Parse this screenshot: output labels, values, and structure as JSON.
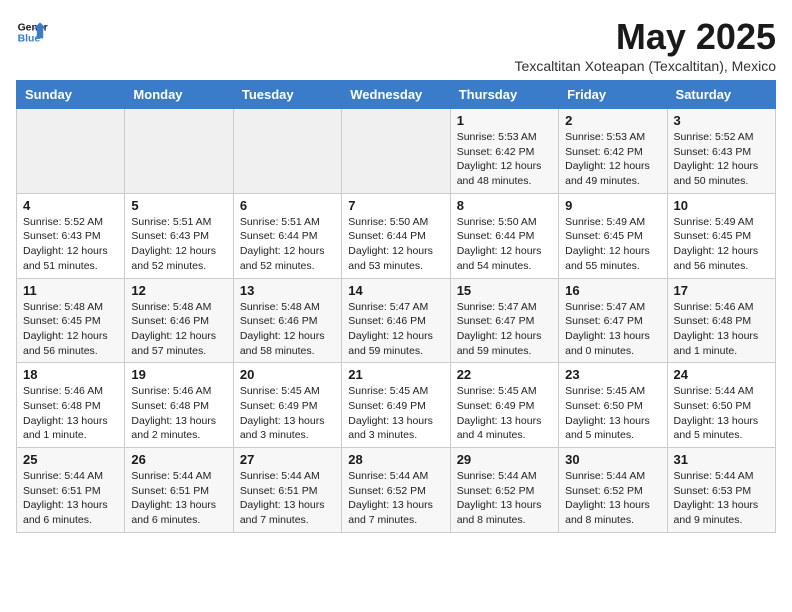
{
  "logo": {
    "line1": "General",
    "line2": "Blue"
  },
  "title": "May 2025",
  "location": "Texcaltitan Xoteapan (Texcaltitan), Mexico",
  "weekdays": [
    "Sunday",
    "Monday",
    "Tuesday",
    "Wednesday",
    "Thursday",
    "Friday",
    "Saturday"
  ],
  "weeks": [
    [
      {
        "day": "",
        "content": ""
      },
      {
        "day": "",
        "content": ""
      },
      {
        "day": "",
        "content": ""
      },
      {
        "day": "",
        "content": ""
      },
      {
        "day": "1",
        "content": "Sunrise: 5:53 AM\nSunset: 6:42 PM\nDaylight: 12 hours and 48 minutes."
      },
      {
        "day": "2",
        "content": "Sunrise: 5:53 AM\nSunset: 6:42 PM\nDaylight: 12 hours and 49 minutes."
      },
      {
        "day": "3",
        "content": "Sunrise: 5:52 AM\nSunset: 6:43 PM\nDaylight: 12 hours and 50 minutes."
      }
    ],
    [
      {
        "day": "4",
        "content": "Sunrise: 5:52 AM\nSunset: 6:43 PM\nDaylight: 12 hours and 51 minutes."
      },
      {
        "day": "5",
        "content": "Sunrise: 5:51 AM\nSunset: 6:43 PM\nDaylight: 12 hours and 52 minutes."
      },
      {
        "day": "6",
        "content": "Sunrise: 5:51 AM\nSunset: 6:44 PM\nDaylight: 12 hours and 52 minutes."
      },
      {
        "day": "7",
        "content": "Sunrise: 5:50 AM\nSunset: 6:44 PM\nDaylight: 12 hours and 53 minutes."
      },
      {
        "day": "8",
        "content": "Sunrise: 5:50 AM\nSunset: 6:44 PM\nDaylight: 12 hours and 54 minutes."
      },
      {
        "day": "9",
        "content": "Sunrise: 5:49 AM\nSunset: 6:45 PM\nDaylight: 12 hours and 55 minutes."
      },
      {
        "day": "10",
        "content": "Sunrise: 5:49 AM\nSunset: 6:45 PM\nDaylight: 12 hours and 56 minutes."
      }
    ],
    [
      {
        "day": "11",
        "content": "Sunrise: 5:48 AM\nSunset: 6:45 PM\nDaylight: 12 hours and 56 minutes."
      },
      {
        "day": "12",
        "content": "Sunrise: 5:48 AM\nSunset: 6:46 PM\nDaylight: 12 hours and 57 minutes."
      },
      {
        "day": "13",
        "content": "Sunrise: 5:48 AM\nSunset: 6:46 PM\nDaylight: 12 hours and 58 minutes."
      },
      {
        "day": "14",
        "content": "Sunrise: 5:47 AM\nSunset: 6:46 PM\nDaylight: 12 hours and 59 minutes."
      },
      {
        "day": "15",
        "content": "Sunrise: 5:47 AM\nSunset: 6:47 PM\nDaylight: 12 hours and 59 minutes."
      },
      {
        "day": "16",
        "content": "Sunrise: 5:47 AM\nSunset: 6:47 PM\nDaylight: 13 hours and 0 minutes."
      },
      {
        "day": "17",
        "content": "Sunrise: 5:46 AM\nSunset: 6:48 PM\nDaylight: 13 hours and 1 minute."
      }
    ],
    [
      {
        "day": "18",
        "content": "Sunrise: 5:46 AM\nSunset: 6:48 PM\nDaylight: 13 hours and 1 minute."
      },
      {
        "day": "19",
        "content": "Sunrise: 5:46 AM\nSunset: 6:48 PM\nDaylight: 13 hours and 2 minutes."
      },
      {
        "day": "20",
        "content": "Sunrise: 5:45 AM\nSunset: 6:49 PM\nDaylight: 13 hours and 3 minutes."
      },
      {
        "day": "21",
        "content": "Sunrise: 5:45 AM\nSunset: 6:49 PM\nDaylight: 13 hours and 3 minutes."
      },
      {
        "day": "22",
        "content": "Sunrise: 5:45 AM\nSunset: 6:49 PM\nDaylight: 13 hours and 4 minutes."
      },
      {
        "day": "23",
        "content": "Sunrise: 5:45 AM\nSunset: 6:50 PM\nDaylight: 13 hours and 5 minutes."
      },
      {
        "day": "24",
        "content": "Sunrise: 5:44 AM\nSunset: 6:50 PM\nDaylight: 13 hours and 5 minutes."
      }
    ],
    [
      {
        "day": "25",
        "content": "Sunrise: 5:44 AM\nSunset: 6:51 PM\nDaylight: 13 hours and 6 minutes."
      },
      {
        "day": "26",
        "content": "Sunrise: 5:44 AM\nSunset: 6:51 PM\nDaylight: 13 hours and 6 minutes."
      },
      {
        "day": "27",
        "content": "Sunrise: 5:44 AM\nSunset: 6:51 PM\nDaylight: 13 hours and 7 minutes."
      },
      {
        "day": "28",
        "content": "Sunrise: 5:44 AM\nSunset: 6:52 PM\nDaylight: 13 hours and 7 minutes."
      },
      {
        "day": "29",
        "content": "Sunrise: 5:44 AM\nSunset: 6:52 PM\nDaylight: 13 hours and 8 minutes."
      },
      {
        "day": "30",
        "content": "Sunrise: 5:44 AM\nSunset: 6:52 PM\nDaylight: 13 hours and 8 minutes."
      },
      {
        "day": "31",
        "content": "Sunrise: 5:44 AM\nSunset: 6:53 PM\nDaylight: 13 hours and 9 minutes."
      }
    ]
  ]
}
